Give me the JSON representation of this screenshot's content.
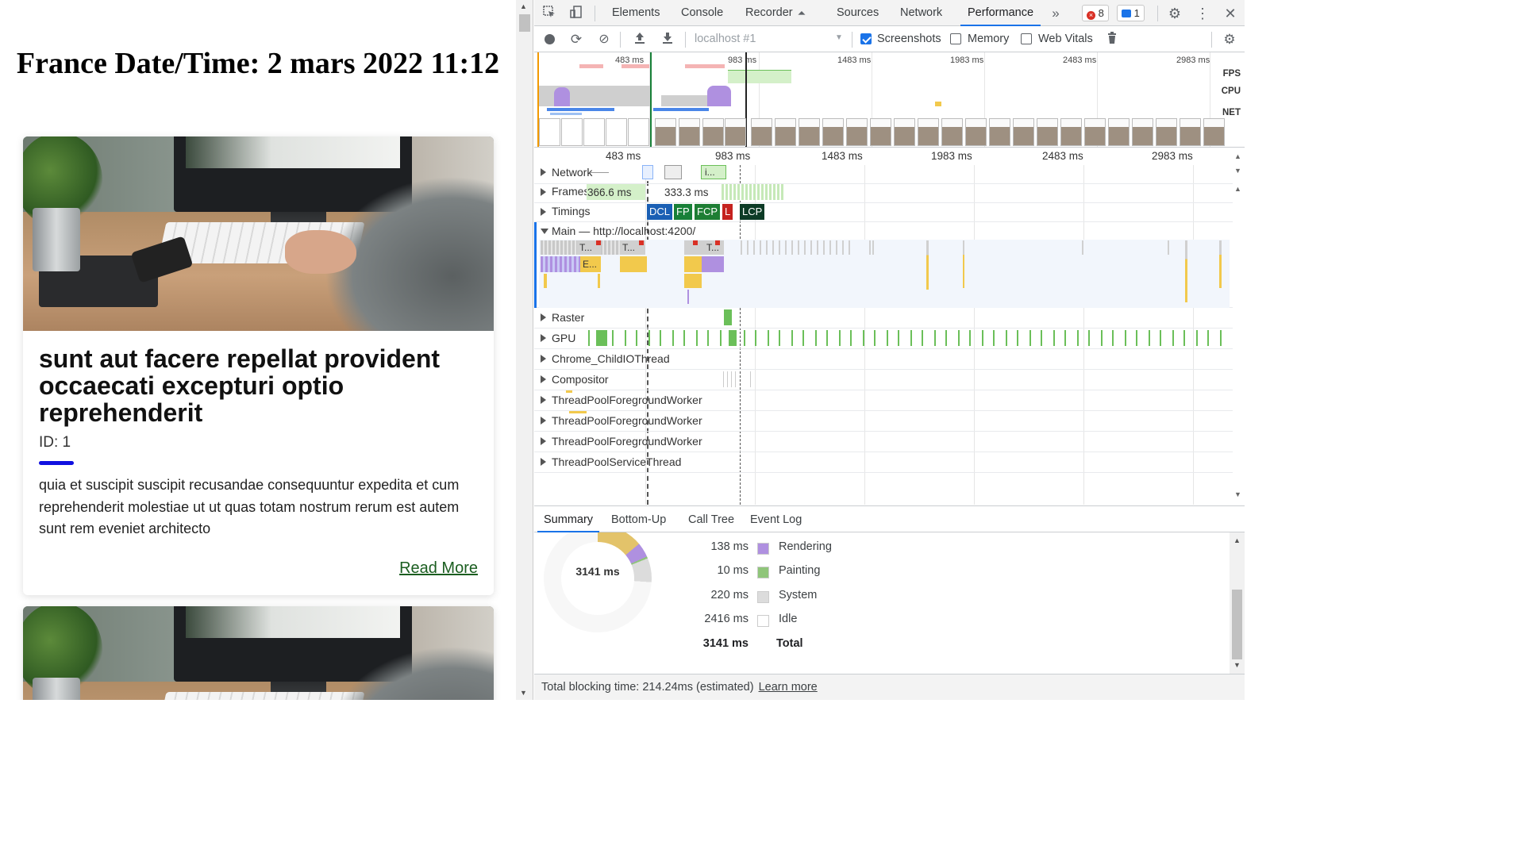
{
  "page": {
    "title": "France Date/Time: 2 mars 2022 11:12",
    "cards": [
      {
        "title": "sunt aut facere repellat provident occaecati excepturi optio reprehenderit",
        "id_text": "ID: 1",
        "body": "quia et suscipit suscipit recusandae consequuntur expedita et cum reprehenderit molestiae ut ut quas totam nostrum rerum est autem sunt rem eveniet architecto",
        "link": "Read More"
      }
    ]
  },
  "devtools": {
    "tabs": [
      "Elements",
      "Console",
      "Recorder",
      "Sources",
      "Network",
      "Performance"
    ],
    "active_tab": "Performance",
    "errors_count": "8",
    "messages_count": "1",
    "toolbar": {
      "target": "localhost #1",
      "screenshots_label": "Screenshots",
      "memory_label": "Memory",
      "web_vitals_label": "Web Vitals",
      "screenshots_checked": true,
      "memory_checked": false,
      "web_vitals_checked": false
    },
    "overview": {
      "ticks": [
        "483 ms",
        "983 ms",
        "1483 ms",
        "1983 ms",
        "2483 ms",
        "2983 ms"
      ],
      "fps_label": "FPS",
      "cpu_label": "CPU",
      "net_label": "NET"
    },
    "ruler_ticks": [
      "483 ms",
      "983 ms",
      "1483 ms",
      "1983 ms",
      "2483 ms",
      "2983 ms"
    ],
    "tracks": {
      "network": "Network",
      "network_item": "i...",
      "frames": "Frames",
      "frame_time_1": "366.6 ms",
      "frame_time_2": "333.3 ms",
      "timings": "Timings",
      "timing_marks": [
        "DCL",
        "FP",
        "FCP",
        "L",
        "LCP"
      ],
      "main": "Main — http://localhost:4200/",
      "main_task_labels": [
        "T...",
        "T...",
        "T...",
        "E..."
      ],
      "raster": "Raster",
      "gpu": "GPU",
      "child_io": "Chrome_ChildIOThread",
      "compositor": "Compositor",
      "pool1": "ThreadPoolForegroundWorker",
      "pool2": "ThreadPoolForegroundWorker",
      "pool3": "ThreadPoolForegroundWorker",
      "service": "ThreadPoolServiceThread"
    },
    "bottom_tabs": [
      "Summary",
      "Bottom-Up",
      "Call Tree",
      "Event Log"
    ],
    "summary": {
      "total_center": "3141 ms",
      "rows": [
        {
          "value": "138 ms",
          "label": "Rendering",
          "color": "#af90e0"
        },
        {
          "value": "10 ms",
          "label": "Painting",
          "color": "#8fc57a"
        },
        {
          "value": "220 ms",
          "label": "System",
          "color": "#dcdcdc"
        },
        {
          "value": "2416 ms",
          "label": "Idle",
          "color": "#ffffff"
        }
      ],
      "total_value": "3141 ms",
      "total_label": "Total"
    },
    "status": {
      "text": "Total blocking time: 214.24ms (estimated)",
      "link": "Learn more"
    },
    "colors": {
      "accent": "#1a73e8",
      "dcl": "#1a5fb4",
      "fp": "#188038",
      "fcp": "#1e7e34",
      "l": "#c5221f",
      "lcp": "#0d3b26",
      "scripting": "#f2c94c",
      "rendering": "#af90e0",
      "painting": "#8fc57a"
    }
  }
}
